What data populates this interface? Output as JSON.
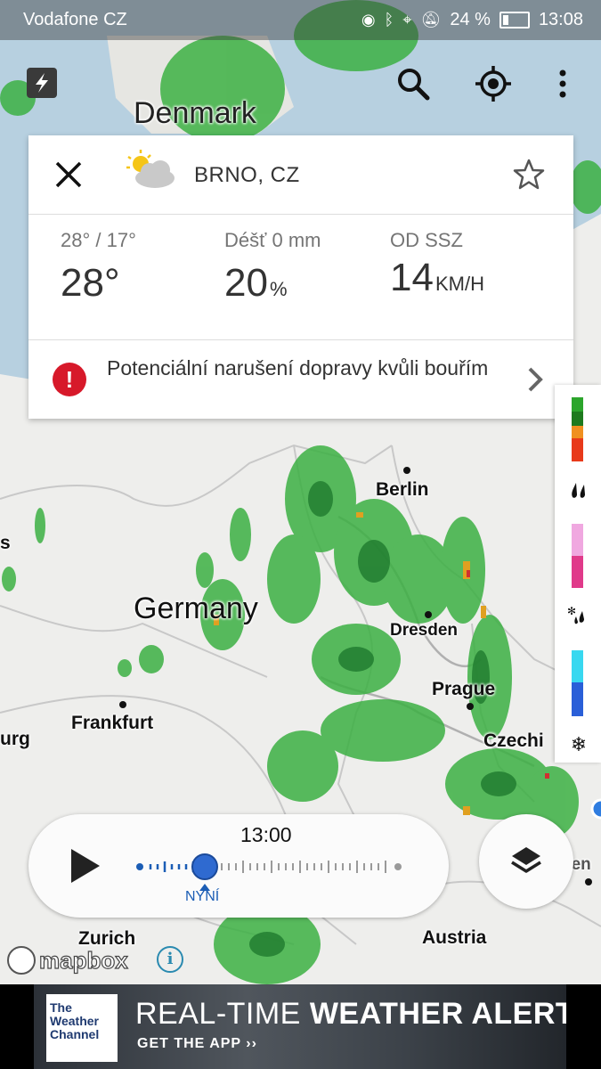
{
  "status_bar": {
    "carrier": "Vodafone CZ",
    "battery_text": "24 %",
    "time": "13:08"
  },
  "map": {
    "labels": {
      "denmark": "Denmark",
      "germany": "Germany",
      "berlin": "Berlin",
      "dresden": "Dresden",
      "prague": "Prague",
      "czechia_partial": "Czechi",
      "frankfurt": "Frankfurt",
      "zurich": "Zurich",
      "austria": "Austria",
      "left_partial_s": "s",
      "left_partial_urg": "urg",
      "vienna_partial": "Vien"
    }
  },
  "weather_card": {
    "city": "BRNO, CZ",
    "temp_range": "28° / 17°",
    "temp_current": "28°",
    "rain_label": "Déšť 0 mm",
    "rain_value": "20",
    "rain_unit": "%",
    "wind_label": "OD SSZ",
    "wind_value": "14",
    "wind_unit": "KM/H",
    "alert_text": "Potenciální narušení dopravy kvůli bouřím"
  },
  "timeline": {
    "time": "13:00",
    "now_label": "NYNÍ",
    "position": 0.25
  },
  "attribution": {
    "mapbox": "mapbox",
    "info": "i"
  },
  "ad": {
    "brand_lines": [
      "The",
      "Weather",
      "Channel"
    ],
    "headline_regular": "REAL-TIME ",
    "headline_bold": "WEATHER ALERTS",
    "cta": "GET THE APP ››"
  },
  "colors": {
    "alert_red": "#d7192a",
    "accent_blue": "#1b5db5",
    "radar_green": "#3cb043"
  },
  "icons": {
    "close": "close-icon",
    "star": "star-icon",
    "search": "search-icon",
    "locate": "crosshair-icon",
    "menu": "more-vert-icon",
    "play": "play-icon",
    "layers": "layers-icon",
    "weather": "partly-cloudy-icon",
    "alert": "exclamation-icon",
    "chevron": "chevron-right-icon"
  }
}
